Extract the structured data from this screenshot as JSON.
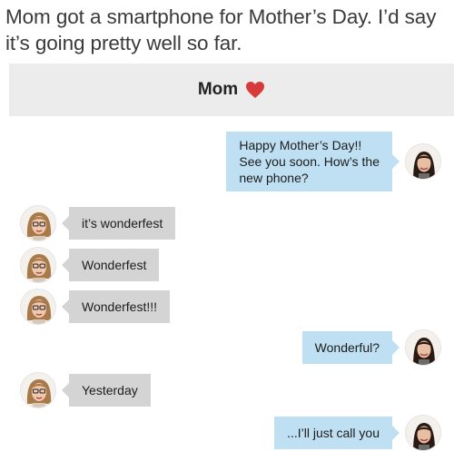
{
  "caption": "Mom got a smartphone for Mother’s Day. I’d say it’s going pretty well so far.",
  "header": {
    "title": "Mom",
    "icon": "heart-icon",
    "icon_color": "#d63a3a"
  },
  "colors": {
    "outgoing_bubble": "#bfe0f2",
    "incoming_bubble": "#d4d4d4",
    "header_bg": "#ececec"
  },
  "messages": [
    {
      "direction": "out",
      "avatar": "daughter-avatar",
      "lines": [
        "Happy Mother’s Day!!",
        "See you soon. How’s the",
        "new phone?"
      ]
    },
    {
      "direction": "in",
      "avatar": "mom-avatar",
      "text": "it’s wonderfest"
    },
    {
      "direction": "in",
      "avatar": "mom-avatar",
      "text": "Wonderfest"
    },
    {
      "direction": "in",
      "avatar": "mom-avatar",
      "text": "Wonderfest!!!"
    },
    {
      "direction": "out",
      "avatar": "daughter-avatar",
      "text": "Wonderful?"
    },
    {
      "direction": "in",
      "avatar": "mom-avatar",
      "text": "Yesterday"
    },
    {
      "direction": "out",
      "avatar": "daughter-avatar",
      "text": "...I’ll just call you"
    }
  ]
}
